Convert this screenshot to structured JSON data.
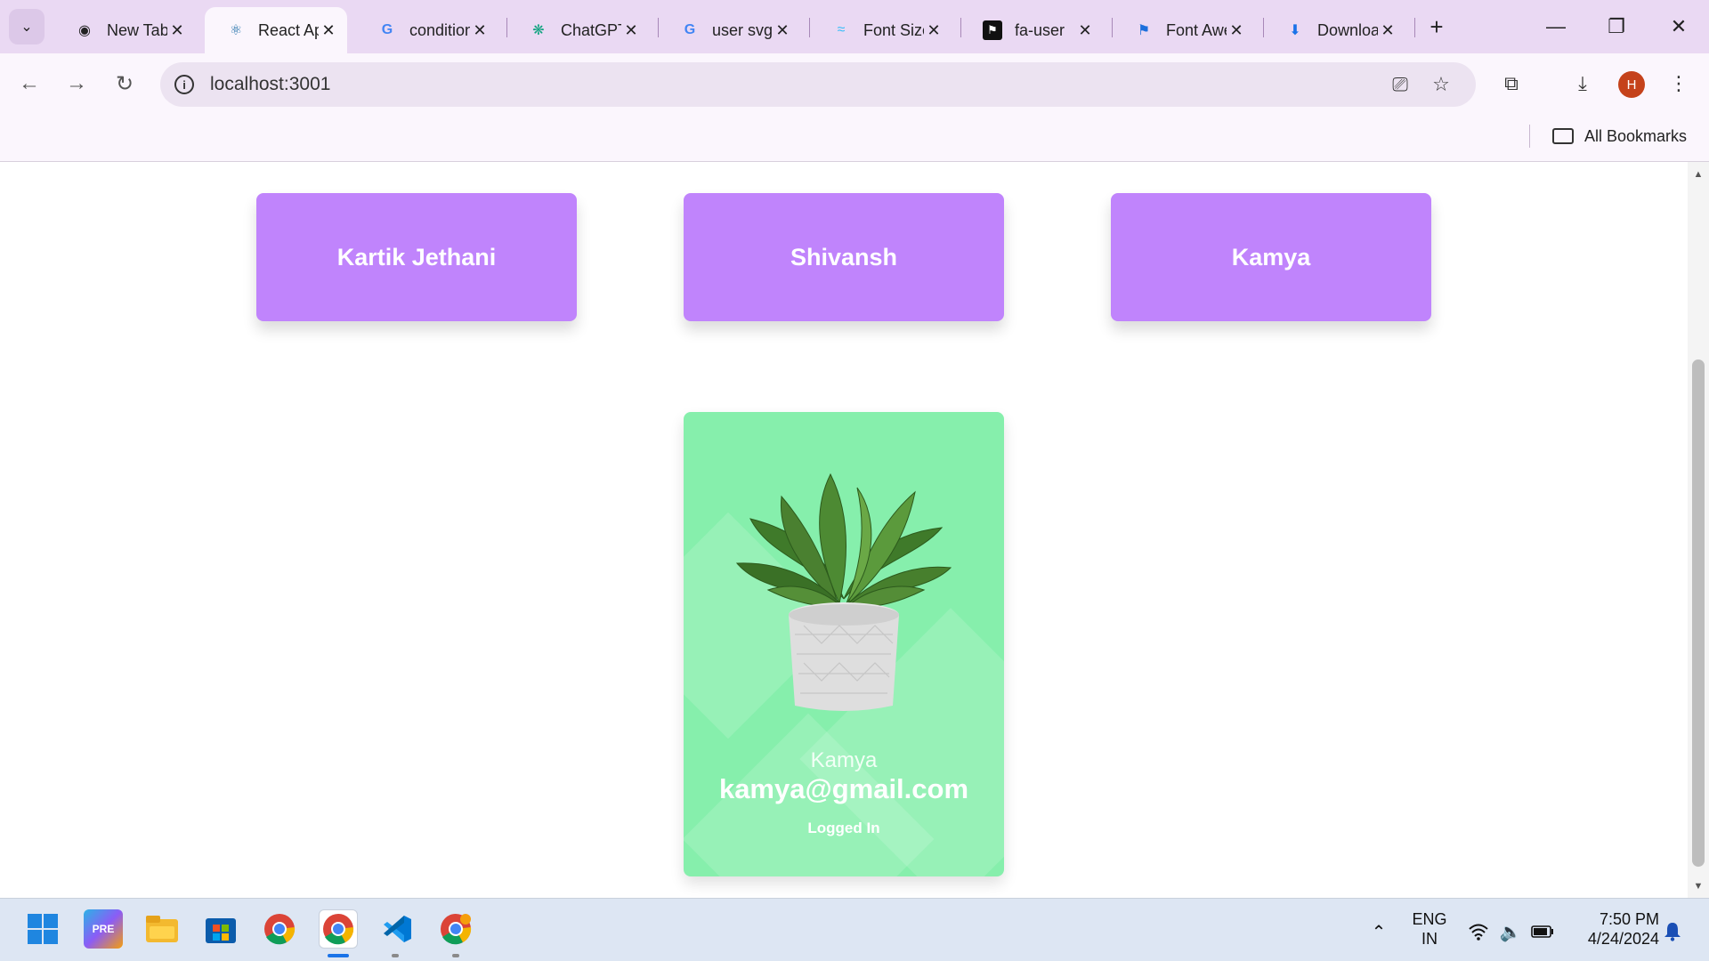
{
  "browser": {
    "tabs": [
      {
        "title": "New Tab",
        "icon": "chrome-icon"
      },
      {
        "title": "React App",
        "icon": "react-icon",
        "active": true
      },
      {
        "title": "conditional",
        "icon": "google-icon"
      },
      {
        "title": "ChatGPT",
        "icon": "chatgpt-icon"
      },
      {
        "title": "user svg",
        "icon": "google-icon"
      },
      {
        "title": "Font Size",
        "icon": "tailwind-icon"
      },
      {
        "title": "fa-user",
        "icon": "fontawesome-flag-icon"
      },
      {
        "title": "Font Awesome",
        "icon": "fontawesome-icon"
      },
      {
        "title": "Downloads",
        "icon": "download-icon"
      }
    ],
    "url": "localhost:3001",
    "avatar_letter": "H",
    "bookmarks_label": "All Bookmarks"
  },
  "users": [
    {
      "name": "Kartik Jethani"
    },
    {
      "name": "Shivansh"
    },
    {
      "name": "Kamya"
    }
  ],
  "profile": {
    "name": "Kamya",
    "email": "kamya@gmail.com",
    "status": "Logged In"
  },
  "taskbar": {
    "language": "ENG",
    "region": "IN",
    "time": "7:50 PM",
    "date": "4/24/2024"
  },
  "colors": {
    "user_card": "#c084fc",
    "profile_card": "#86efac",
    "chrome_frame": "#ead9f3"
  }
}
